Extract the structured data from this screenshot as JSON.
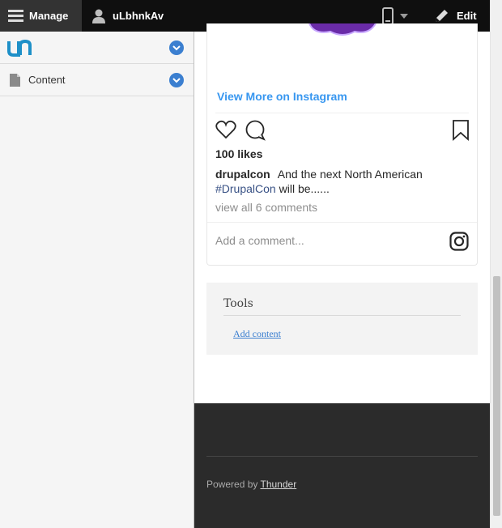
{
  "toolbar": {
    "manage_label": "Manage",
    "user_label": "uLbhnkAv",
    "edit_label": "Edit"
  },
  "tray": {
    "logo_icon": "thunder-logo-icon",
    "content_label": "Content"
  },
  "instagram": {
    "view_more": "View More on Instagram",
    "likes": "100 likes",
    "username": "drupalcon",
    "caption_text": "And the next North American",
    "hashtag": "#DrupalCon",
    "caption_tail": "will be......",
    "view_all": "view all 6 comments",
    "comment_placeholder": "Add a comment..."
  },
  "tools": {
    "title": "Tools",
    "add_content": "Add content"
  },
  "footer": {
    "powered_prefix": "Powered by",
    "powered_link": "Thunder"
  },
  "colors": {
    "accent": "#3b7fd0",
    "instagram_blue": "#3897f0",
    "toolbar_bg": "#0f0f0f"
  }
}
